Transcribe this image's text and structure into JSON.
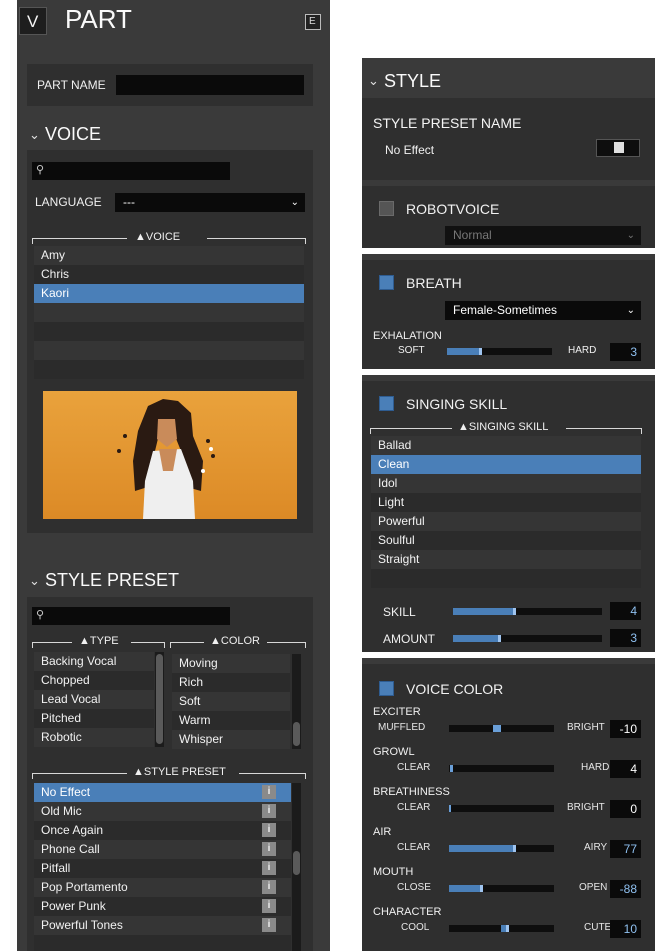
{
  "header": {
    "toggle": "V",
    "title": "PART",
    "edit_badge": "E"
  },
  "part": {
    "name_label": "PART NAME",
    "name_value": ""
  },
  "voice": {
    "section_title": "VOICE",
    "search_placeholder": "",
    "language_label": "LANGUAGE",
    "language_value": "---",
    "list_header": "▲VOICE",
    "items": [
      "Amy",
      "Chris",
      "Kaori"
    ],
    "selected": "Kaori"
  },
  "style_preset": {
    "section_title": "STYLE PRESET",
    "search_placeholder": "",
    "type_header": "▲TYPE",
    "types": [
      "Backing Vocal",
      "Chopped",
      "Lead Vocal",
      "Pitched",
      "Robotic"
    ],
    "color_header": "▲COLOR",
    "colors": [
      "Moving",
      "Rich",
      "Soft",
      "Warm",
      "Whisper"
    ],
    "preset_header": "▲STYLE PRESET",
    "presets": [
      "No Effect",
      "Old Mic",
      "Once Again",
      "Phone Call",
      "Pitfall",
      "Pop Portamento",
      "Power Punk",
      "Powerful Tones"
    ],
    "selected": "No Effect",
    "info_label": "i"
  },
  "style": {
    "section_title": "STYLE",
    "preset_name_label": "STYLE PRESET NAME",
    "preset_name_value": "No Effect",
    "save_icon": "save-icon"
  },
  "robotvoice": {
    "label": "ROBOTVOICE",
    "enabled": false,
    "mode": "Normal"
  },
  "breath": {
    "label": "BREATH",
    "enabled": true,
    "mode": "Female-Sometimes",
    "exhalation_label": "EXHALATION",
    "min_label": "SOFT",
    "max_label": "HARD",
    "value": "3",
    "level": 0.3
  },
  "singing_skill": {
    "label": "SINGING SKILL",
    "enabled": true,
    "list_header": "▲SINGING SKILL",
    "items": [
      "Ballad",
      "Clean",
      "Idol",
      "Light",
      "Powerful",
      "Soulful",
      "Straight"
    ],
    "selected": "Clean",
    "skill_label": "SKILL",
    "skill_value": "4",
    "skill_level": 0.4,
    "amount_label": "AMOUNT",
    "amount_value": "3",
    "amount_level": 0.3
  },
  "voice_color": {
    "label": "VOICE COLOR",
    "enabled": true,
    "params": [
      {
        "name": "EXCITER",
        "min": "MUFFLED",
        "max": "BRIGHT",
        "value": "-10"
      },
      {
        "name": "GROWL",
        "min": "CLEAR",
        "max": "HARD",
        "value": "4"
      },
      {
        "name": "BREATHINESS",
        "min": "CLEAR",
        "max": "BRIGHT",
        "value": "0"
      },
      {
        "name": "AIR",
        "min": "CLEAR",
        "max": "AIRY",
        "value": "77"
      },
      {
        "name": "MOUTH",
        "min": "CLOSE",
        "max": "OPEN",
        "value": "-88"
      },
      {
        "name": "CHARACTER",
        "min": "COOL",
        "max": "CUTE",
        "value": "10"
      }
    ]
  },
  "colors": {
    "accent": "#4a7fb8",
    "panel": "#3d3d3d",
    "inset": "#2c2c2c",
    "field": "#0a0a0a",
    "portrait_bg": "#e0952e"
  }
}
